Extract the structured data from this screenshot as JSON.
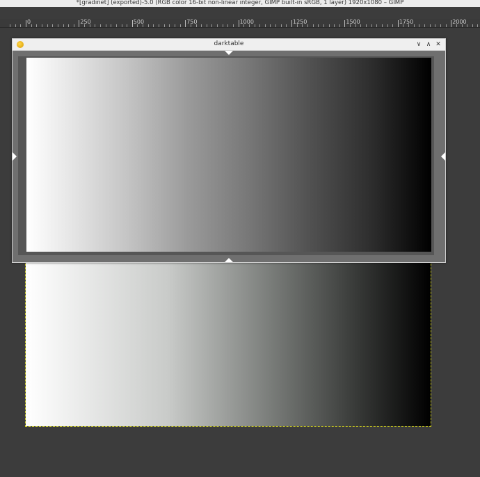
{
  "gimp": {
    "window_title": "*[gradinet] (exported)-5.0 (RGB color 16-bit non-linear integer, GIMP built-in sRGB, 1 layer) 1920x1080 – GIMP"
  },
  "ruler": {
    "labels": [
      "0",
      "250",
      "500",
      "750",
      "1000",
      "1250",
      "1500",
      "1750",
      "2000"
    ]
  },
  "darktable": {
    "title": "darktable",
    "minimize": "∨",
    "maximize": "∧",
    "close": "✕"
  },
  "colors": {
    "canvas_bg": "#3c3c3c",
    "selection_outline": "#c8c820",
    "darktable_icon": "#f0b400"
  }
}
